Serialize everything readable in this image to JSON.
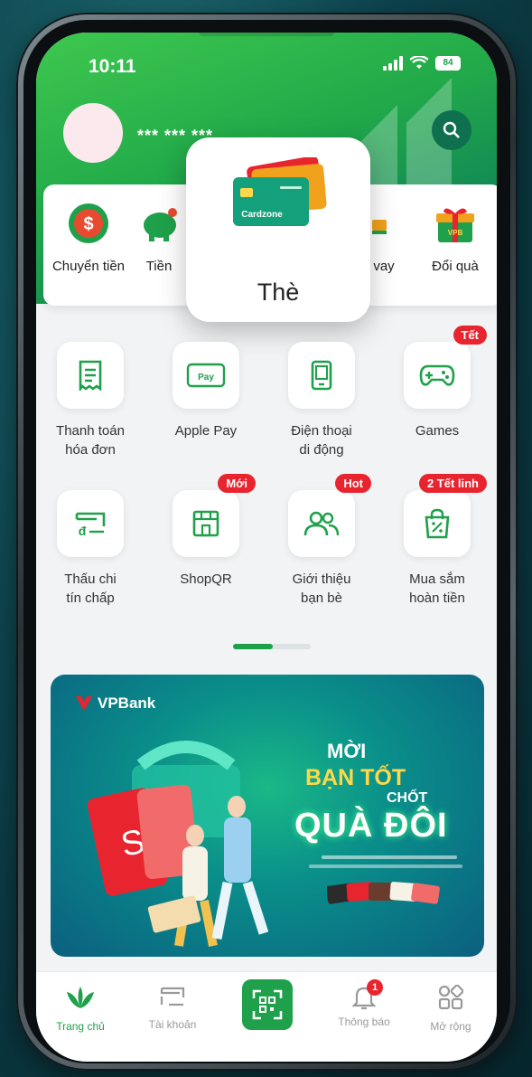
{
  "status_bar": {
    "time": "10:11",
    "battery": "84"
  },
  "header": {
    "balance_masked": "*** *** ***"
  },
  "quick_actions": [
    {
      "label": "Chuyển tiền",
      "icon": "dollar-transfer-icon"
    },
    {
      "label": "Tiền",
      "icon": "piggy-bank-icon"
    },
    {
      "label": "vay",
      "icon": "loan-icon"
    },
    {
      "label": "Đổi quà",
      "icon": "gift-icon"
    }
  ],
  "popup": {
    "label": "Thè",
    "card_text": "Cardzone"
  },
  "services": [
    {
      "label_line1": "Thanh toán",
      "label_line2": "hóa đơn",
      "badge": ""
    },
    {
      "label_line1": "Apple Pay",
      "label_line2": "",
      "badge": "",
      "icon_text": "Pay"
    },
    {
      "label_line1": "Điện thoại",
      "label_line2": "di động",
      "badge": ""
    },
    {
      "label_line1": "Games",
      "label_line2": "",
      "badge": "Tết"
    },
    {
      "label_line1": "Thấu chi",
      "label_line2": "tín chấp",
      "badge": ""
    },
    {
      "label_line1": "ShopQR",
      "label_line2": "",
      "badge": "Mới"
    },
    {
      "label_line1": "Giới thiệu",
      "label_line2": "bạn bè",
      "badge": "Hot"
    },
    {
      "label_line1": "Mua sắm",
      "label_line2": "hoàn tiền",
      "badge": "2 Tết linh"
    }
  ],
  "pager": {
    "active_page": 1,
    "pages": 2
  },
  "banner": {
    "brand": "VPBank",
    "line1": "MỜI",
    "line2": "BẠN TỐT",
    "line3": "CHỐT",
    "line4": "QUÀ ĐÔI"
  },
  "tabs": [
    {
      "label": "Trang chủ",
      "icon": "home-leaf-icon",
      "active": true
    },
    {
      "label": "Tài khoản",
      "icon": "account-icon",
      "active": false
    },
    {
      "label": "",
      "icon": "qr-scan-icon",
      "active": false
    },
    {
      "label": "Thông báo",
      "icon": "bell-icon",
      "active": false,
      "count": "1"
    },
    {
      "label": "Mở rộng",
      "icon": "grid-more-icon",
      "active": false
    }
  ],
  "colors": {
    "brand_green": "#1fa04a",
    "badge_red": "#e8242f",
    "screen_bg": "#f1f3f4"
  }
}
